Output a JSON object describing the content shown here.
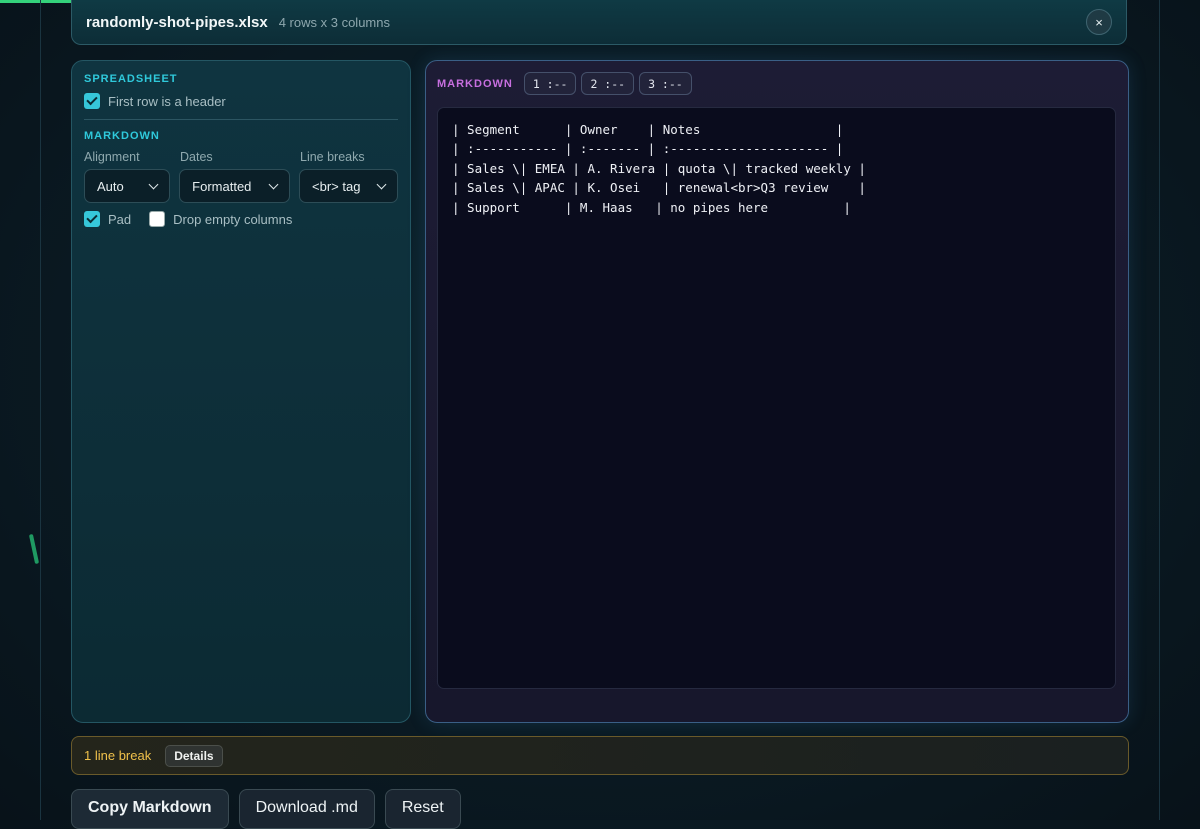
{
  "file": {
    "name": "randomly-shot-pipes.xlsx",
    "meta": "4 rows x 3 columns",
    "close_label": "×"
  },
  "spreadsheet": {
    "section_label": "SPREADSHEET",
    "first_row_header_label": "First row is a header",
    "first_row_header_checked": true
  },
  "markdown_options": {
    "section_label": "MARKDOWN",
    "alignment": {
      "label": "Alignment",
      "value": "Auto"
    },
    "dates": {
      "label": "Dates",
      "value": "Formatted"
    },
    "line_breaks": {
      "label": "Line breaks",
      "value": "<br> tag"
    },
    "pad_label": "Pad",
    "pad_checked": true,
    "drop_empty_label": "Drop empty columns",
    "drop_empty_checked": false
  },
  "output": {
    "label": "MARKDOWN",
    "column_chips": [
      "1 :--",
      "2 :--",
      "3 :--"
    ],
    "text": "| Segment      | Owner    | Notes                  |\n| :----------- | :------- | :--------------------- |\n| Sales \\| EMEA | A. Rivera | quota \\| tracked weekly |\n| Sales \\| APAC | K. Osei   | renewal<br>Q3 review    |\n| Support      | M. Haas   | no pipes here          |"
  },
  "notice": {
    "text": "1 line break",
    "details_label": "Details"
  },
  "actions": {
    "copy_label": "Copy Markdown",
    "download_label": "Download .md",
    "reset_label": "Reset"
  },
  "colors": {
    "accent_cyan": "#36c7da",
    "accent_magenta": "#c86fe0",
    "warning": "#f0c14a",
    "progress": "#34d27b"
  }
}
